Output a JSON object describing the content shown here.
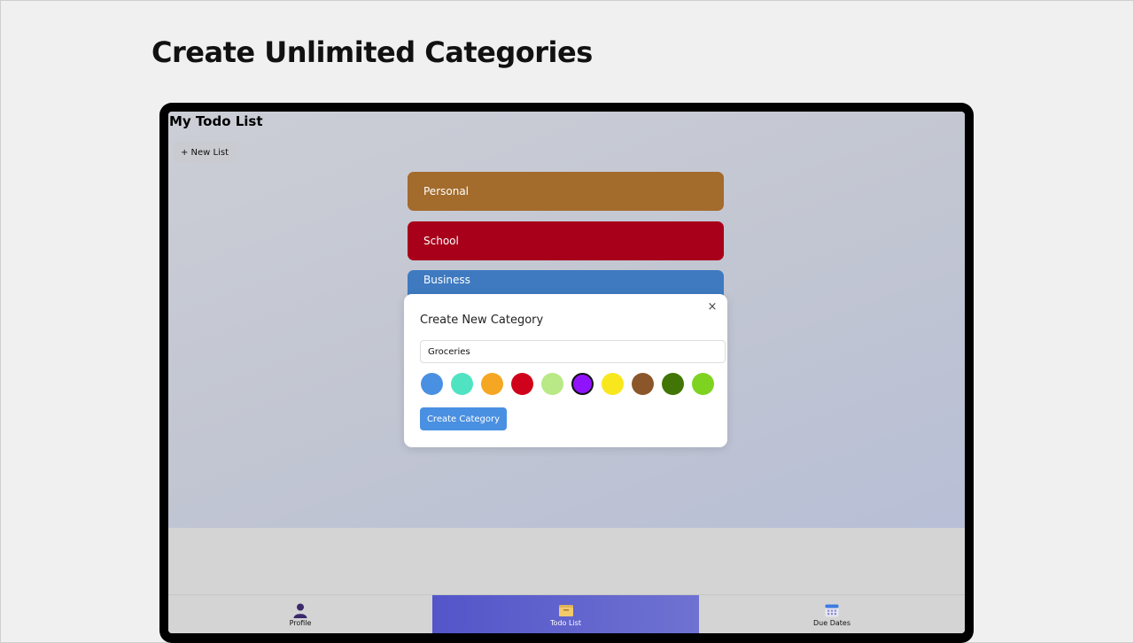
{
  "page": {
    "heading": "Create Unlimited Categories"
  },
  "app": {
    "title": "My Todo List",
    "new_list_label": "+ New List"
  },
  "categories": [
    {
      "label": "Personal",
      "color": "#a36b2c"
    },
    {
      "label": "School",
      "color": "#a8001a"
    },
    {
      "label": "Business",
      "color": "#3f7ac0"
    }
  ],
  "modal": {
    "title": "Create New Category",
    "close_icon": "×",
    "name_value": "Groceries",
    "create_label": "Create Category",
    "colors": [
      "#4a90e2",
      "#50e3c2",
      "#f5a623",
      "#d0021b",
      "#b8e986",
      "#9013fe",
      "#f8e71c",
      "#8b572a",
      "#417505",
      "#7ed321"
    ],
    "selected_color": "#9013fe"
  },
  "tabs": [
    {
      "label": "Profile",
      "icon": "person-icon",
      "active": false
    },
    {
      "label": "Todo List",
      "icon": "folder-icon",
      "active": true
    },
    {
      "label": "Due Dates",
      "icon": "calendar-icon",
      "active": false
    }
  ]
}
